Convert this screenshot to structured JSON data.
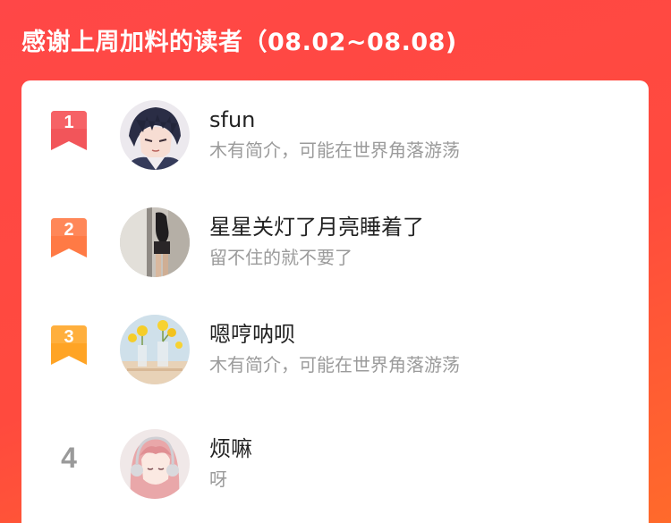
{
  "header": {
    "title": "感谢上周加料的读者（08.02~08.08)"
  },
  "colors": {
    "background_red": "#ff4747",
    "background_orange": "#ff6a2b",
    "rank1_badge": "#f2555a",
    "rank2_badge": "#ff7a45",
    "rank3_badge": "#ffa425",
    "rank_plain_text": "#9a9a9a"
  },
  "readers": [
    {
      "rank": "1",
      "name": "sfun",
      "bio": "木有简介，可能在世界角落游荡",
      "avatar_icon": "anime-boy-avatar-icon"
    },
    {
      "rank": "2",
      "name": "星星关灯了月亮睡着了",
      "bio": "留不住的就不要了",
      "avatar_icon": "mirror-selfie-avatar-icon"
    },
    {
      "rank": "3",
      "name": "嗯哼呐呗",
      "bio": "木有简介，可能在世界角落游荡",
      "avatar_icon": "yellow-flowers-avatar-icon"
    },
    {
      "rank": "4",
      "name": "烦嘛",
      "bio": "呀",
      "avatar_icon": "anime-girl-headphones-avatar-icon"
    }
  ]
}
